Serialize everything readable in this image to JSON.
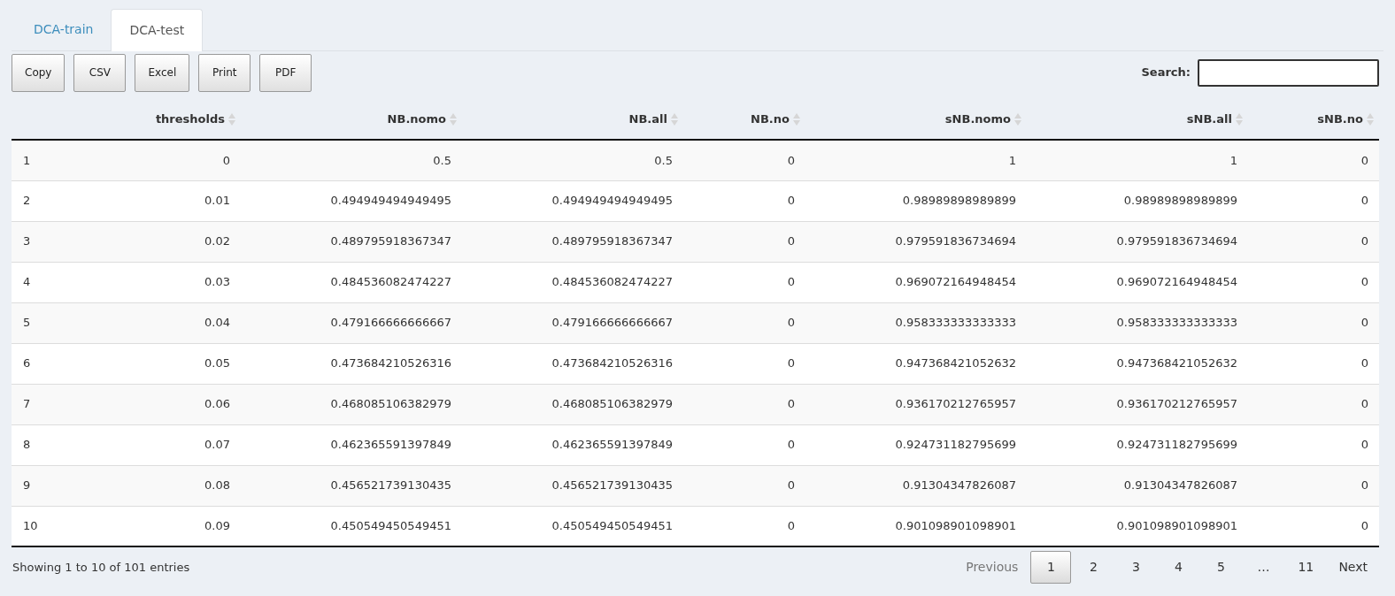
{
  "tabs": [
    {
      "label": "DCA-train",
      "selected": false
    },
    {
      "label": "DCA-test",
      "selected": true
    }
  ],
  "buttons": [
    "Copy",
    "CSV",
    "Excel",
    "Print",
    "PDF"
  ],
  "search": {
    "label": "Search:"
  },
  "table": {
    "columns": [
      "",
      "thresholds",
      "NB.nomo",
      "NB.all",
      "NB.no",
      "sNB.nomo",
      "sNB.all",
      "sNB.no"
    ],
    "rows": [
      [
        "1",
        "0",
        "0.5",
        "0.5",
        "0",
        "1",
        "1",
        "0"
      ],
      [
        "2",
        "0.01",
        "0.494949494949495",
        "0.494949494949495",
        "0",
        "0.98989898989899",
        "0.98989898989899",
        "0"
      ],
      [
        "3",
        "0.02",
        "0.489795918367347",
        "0.489795918367347",
        "0",
        "0.979591836734694",
        "0.979591836734694",
        "0"
      ],
      [
        "4",
        "0.03",
        "0.484536082474227",
        "0.484536082474227",
        "0",
        "0.969072164948454",
        "0.969072164948454",
        "0"
      ],
      [
        "5",
        "0.04",
        "0.479166666666667",
        "0.479166666666667",
        "0",
        "0.958333333333333",
        "0.958333333333333",
        "0"
      ],
      [
        "6",
        "0.05",
        "0.473684210526316",
        "0.473684210526316",
        "0",
        "0.947368421052632",
        "0.947368421052632",
        "0"
      ],
      [
        "7",
        "0.06",
        "0.468085106382979",
        "0.468085106382979",
        "0",
        "0.936170212765957",
        "0.936170212765957",
        "0"
      ],
      [
        "8",
        "0.07",
        "0.462365591397849",
        "0.462365591397849",
        "0",
        "0.924731182795699",
        "0.924731182795699",
        "0"
      ],
      [
        "9",
        "0.08",
        "0.456521739130435",
        "0.456521739130435",
        "0",
        "0.91304347826087",
        "0.91304347826087",
        "0"
      ],
      [
        "10",
        "0.09",
        "0.450549450549451",
        "0.450549450549451",
        "0",
        "0.901098901098901",
        "0.901098901098901",
        "0"
      ]
    ]
  },
  "info": "Showing 1 to 10 of 101 entries",
  "pagination": [
    {
      "kind": "previous",
      "label": "Previous",
      "disabled": true
    },
    {
      "kind": "page",
      "label": "1",
      "selected": true
    },
    {
      "kind": "page",
      "label": "2",
      "selected": false
    },
    {
      "kind": "page",
      "label": "3",
      "selected": false
    },
    {
      "kind": "page",
      "label": "4",
      "selected": false
    },
    {
      "kind": "page",
      "label": "5",
      "selected": false
    },
    {
      "kind": "ellipsis",
      "label": "…"
    },
    {
      "kind": "page",
      "label": "11",
      "selected": false
    },
    {
      "kind": "next",
      "label": "Next",
      "disabled": false
    }
  ]
}
